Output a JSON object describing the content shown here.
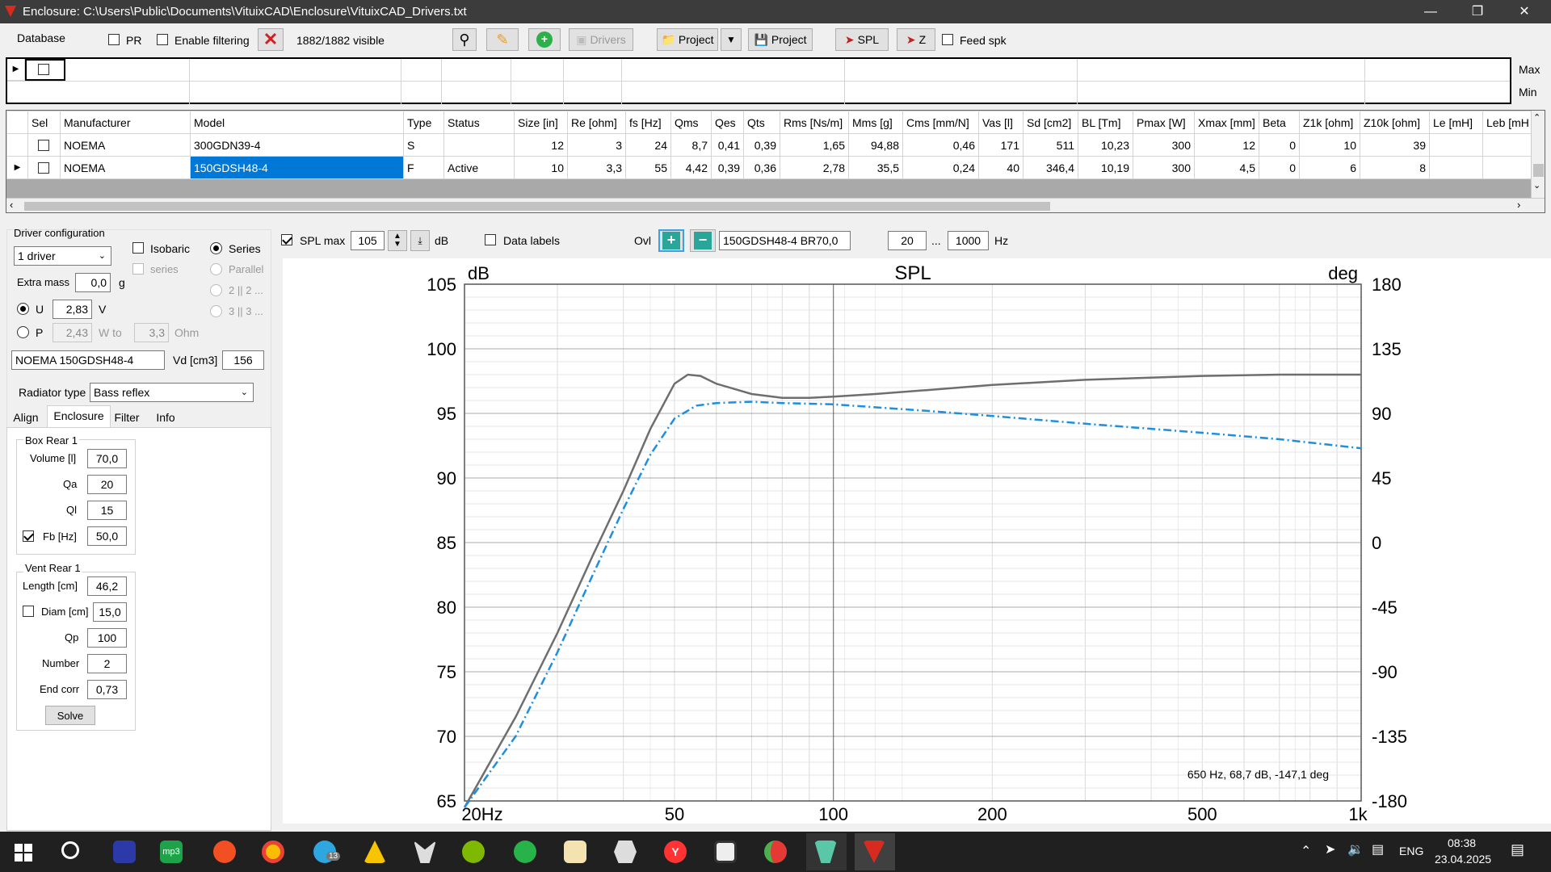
{
  "window": {
    "title": "Enclosure: C:\\Users\\Public\\Documents\\VituixCAD\\Enclosure\\VituixCAD_Drivers.txt",
    "minimize": "—",
    "maximize": "❐",
    "close": "✕"
  },
  "toolbar": {
    "database": "Database",
    "pr": "PR",
    "enable_filtering": "Enable filtering",
    "visible_count": "1882/1882 visible",
    "drivers": "Drivers",
    "project_open": "Project",
    "project_save": "Project",
    "spl": "SPL",
    "z": "Z",
    "feed_spk": "Feed spk"
  },
  "filter": {
    "max": "Max",
    "min": "Min"
  },
  "table": {
    "columns": [
      "Sel",
      "Manufacturer",
      "Model",
      "Type",
      "Status",
      "Size [in]",
      "Re [ohm]",
      "fs [Hz]",
      "Qms",
      "Qes",
      "Qts",
      "Rms [Ns/m]",
      "Mms [g]",
      "Cms [mm/N]",
      "Vas [l]",
      "Sd [cm2]",
      "BL [Tm]",
      "Pmax [W]",
      "Xmax [mm]",
      "Beta",
      "Z1k [ohm]",
      "Z10k [ohm]",
      "Le [mH]",
      "Leb [mH"
    ],
    "rows": [
      [
        "",
        "NOEMA",
        "300GDN39-4",
        "S",
        "",
        "12",
        "3",
        "24",
        "8,7",
        "0,41",
        "0,39",
        "1,65",
        "94,88",
        "0,46",
        "171",
        "511",
        "10,23",
        "300",
        "12",
        "0",
        "10",
        "39",
        "",
        ""
      ],
      [
        "",
        "NOEMA",
        "150GDSH48-4",
        "F",
        "Active",
        "10",
        "3,3",
        "55",
        "4,42",
        "0,39",
        "0,36",
        "2,78",
        "35,5",
        "0,24",
        "40",
        "346,4",
        "10,19",
        "300",
        "4,5",
        "0",
        "6",
        "8",
        "",
        ""
      ]
    ]
  },
  "driver_config": {
    "title": "Driver configuration",
    "count": "1 driver",
    "isobaric": "Isobaric",
    "series_small": "series",
    "series": "Series",
    "parallel": "Parallel",
    "opt2": "2 || 2 ...",
    "opt3": "3 || 3 ...",
    "extra_mass_label": "Extra mass",
    "extra_mass": "0,0",
    "g": "g",
    "u": "U",
    "u_val": "2,83",
    "v": "V",
    "p": "P",
    "p_val": "2,43",
    "w_to": "W to",
    "ohm_val": "3,3",
    "ohm": "Ohm",
    "driver_name": "NOEMA 150GDSH48-4",
    "vd_label": "Vd [cm3]",
    "vd": "156"
  },
  "radiator": {
    "label": "Radiator type",
    "value": "Bass reflex"
  },
  "tabs": [
    "Align",
    "Enclosure",
    "Filter",
    "Info"
  ],
  "box": {
    "title": "Box Rear 1",
    "volume_label": "Volume [l]",
    "volume": "70,0",
    "qa_label": "Qa",
    "qa": "20",
    "ql_label": "Ql",
    "ql": "15",
    "fb_label": "Fb [Hz]",
    "fb": "50,0"
  },
  "vent": {
    "title": "Vent Rear 1",
    "length_label": "Length [cm]",
    "length": "46,2",
    "diam_label": "Diam [cm]",
    "diam": "15,0",
    "qp_label": "Qp",
    "qp": "100",
    "number_label": "Number",
    "number": "2",
    "endcorr_label": "End corr",
    "endcorr": "0,73",
    "solve": "Solve"
  },
  "chart_controls": {
    "spl_max_label": "SPL max",
    "spl_max": "105",
    "db": "dB",
    "data_labels": "Data labels",
    "ovl": "Ovl",
    "overlay_name": "150GDSH48-4 BR70,0",
    "f_from": "20",
    "dots": "...",
    "f_to": "1000",
    "hz": "Hz"
  },
  "chart_data": {
    "type": "line",
    "title": "SPL",
    "ylabel": "dB",
    "y2label": "deg",
    "xscale": "log",
    "xlim": [
      20,
      1000
    ],
    "ylim": [
      65,
      105
    ],
    "y2lim": [
      -180,
      180
    ],
    "xticks": [
      "20Hz",
      "50",
      "100",
      "200",
      "500",
      "1k"
    ],
    "xtick_values": [
      20,
      50,
      100,
      200,
      500,
      1000
    ],
    "yticks": [
      105,
      100,
      95,
      90,
      85,
      80,
      75,
      70,
      65
    ],
    "y2ticks": [
      180,
      135,
      90,
      45,
      0,
      -45,
      -90,
      -135,
      -180
    ],
    "grid": true,
    "cursor_readout": "650 Hz, 68,7 dB, -147,1 deg",
    "series": [
      {
        "color": "#6e6e6e",
        "style": "solid",
        "x": [
          20,
          25,
          30,
          35,
          40,
          45,
          50,
          53,
          56,
          60,
          70,
          80,
          90,
          100,
          120,
          150,
          200,
          300,
          500,
          700,
          1000
        ],
        "y": [
          64.5,
          71.5,
          78,
          84,
          89,
          93.8,
          97.3,
          98.0,
          97.9,
          97.3,
          96.5,
          96.2,
          96.2,
          96.3,
          96.5,
          96.8,
          97.2,
          97.6,
          97.9,
          98.0,
          98.0
        ]
      },
      {
        "color": "#1e8fe0",
        "style": "dashdot",
        "x": [
          20,
          25,
          30,
          35,
          40,
          45,
          50,
          55,
          60,
          70,
          80,
          100,
          150,
          200,
          300,
          500,
          700,
          1000
        ],
        "y": [
          64.5,
          70,
          76.5,
          82.5,
          87.6,
          91.8,
          94.6,
          95.6,
          95.8,
          95.9,
          95.8,
          95.7,
          95.2,
          94.8,
          94.2,
          93.5,
          93.0,
          92.3
        ]
      }
    ]
  },
  "taskbar": {
    "lang": "ENG",
    "time": "08:38",
    "date": "23.04.2025",
    "badge": "13"
  }
}
